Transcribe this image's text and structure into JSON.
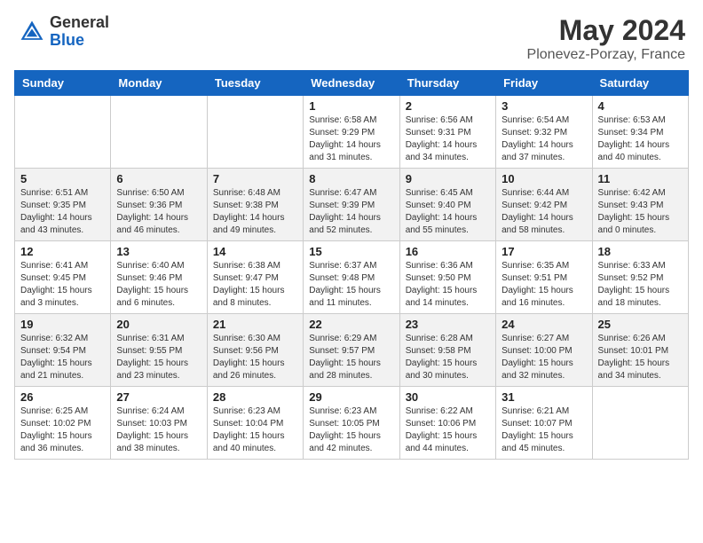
{
  "header": {
    "logo_general": "General",
    "logo_blue": "Blue",
    "title": "May 2024",
    "subtitle": "Plonevez-Porzay, France"
  },
  "days_of_week": [
    "Sunday",
    "Monday",
    "Tuesday",
    "Wednesday",
    "Thursday",
    "Friday",
    "Saturday"
  ],
  "weeks": [
    [
      {
        "day": "",
        "info": ""
      },
      {
        "day": "",
        "info": ""
      },
      {
        "day": "",
        "info": ""
      },
      {
        "day": "1",
        "info": "Sunrise: 6:58 AM\nSunset: 9:29 PM\nDaylight: 14 hours\nand 31 minutes."
      },
      {
        "day": "2",
        "info": "Sunrise: 6:56 AM\nSunset: 9:31 PM\nDaylight: 14 hours\nand 34 minutes."
      },
      {
        "day": "3",
        "info": "Sunrise: 6:54 AM\nSunset: 9:32 PM\nDaylight: 14 hours\nand 37 minutes."
      },
      {
        "day": "4",
        "info": "Sunrise: 6:53 AM\nSunset: 9:34 PM\nDaylight: 14 hours\nand 40 minutes."
      }
    ],
    [
      {
        "day": "5",
        "info": "Sunrise: 6:51 AM\nSunset: 9:35 PM\nDaylight: 14 hours\nand 43 minutes."
      },
      {
        "day": "6",
        "info": "Sunrise: 6:50 AM\nSunset: 9:36 PM\nDaylight: 14 hours\nand 46 minutes."
      },
      {
        "day": "7",
        "info": "Sunrise: 6:48 AM\nSunset: 9:38 PM\nDaylight: 14 hours\nand 49 minutes."
      },
      {
        "day": "8",
        "info": "Sunrise: 6:47 AM\nSunset: 9:39 PM\nDaylight: 14 hours\nand 52 minutes."
      },
      {
        "day": "9",
        "info": "Sunrise: 6:45 AM\nSunset: 9:40 PM\nDaylight: 14 hours\nand 55 minutes."
      },
      {
        "day": "10",
        "info": "Sunrise: 6:44 AM\nSunset: 9:42 PM\nDaylight: 14 hours\nand 58 minutes."
      },
      {
        "day": "11",
        "info": "Sunrise: 6:42 AM\nSunset: 9:43 PM\nDaylight: 15 hours\nand 0 minutes."
      }
    ],
    [
      {
        "day": "12",
        "info": "Sunrise: 6:41 AM\nSunset: 9:45 PM\nDaylight: 15 hours\nand 3 minutes."
      },
      {
        "day": "13",
        "info": "Sunrise: 6:40 AM\nSunset: 9:46 PM\nDaylight: 15 hours\nand 6 minutes."
      },
      {
        "day": "14",
        "info": "Sunrise: 6:38 AM\nSunset: 9:47 PM\nDaylight: 15 hours\nand 8 minutes."
      },
      {
        "day": "15",
        "info": "Sunrise: 6:37 AM\nSunset: 9:48 PM\nDaylight: 15 hours\nand 11 minutes."
      },
      {
        "day": "16",
        "info": "Sunrise: 6:36 AM\nSunset: 9:50 PM\nDaylight: 15 hours\nand 14 minutes."
      },
      {
        "day": "17",
        "info": "Sunrise: 6:35 AM\nSunset: 9:51 PM\nDaylight: 15 hours\nand 16 minutes."
      },
      {
        "day": "18",
        "info": "Sunrise: 6:33 AM\nSunset: 9:52 PM\nDaylight: 15 hours\nand 18 minutes."
      }
    ],
    [
      {
        "day": "19",
        "info": "Sunrise: 6:32 AM\nSunset: 9:54 PM\nDaylight: 15 hours\nand 21 minutes."
      },
      {
        "day": "20",
        "info": "Sunrise: 6:31 AM\nSunset: 9:55 PM\nDaylight: 15 hours\nand 23 minutes."
      },
      {
        "day": "21",
        "info": "Sunrise: 6:30 AM\nSunset: 9:56 PM\nDaylight: 15 hours\nand 26 minutes."
      },
      {
        "day": "22",
        "info": "Sunrise: 6:29 AM\nSunset: 9:57 PM\nDaylight: 15 hours\nand 28 minutes."
      },
      {
        "day": "23",
        "info": "Sunrise: 6:28 AM\nSunset: 9:58 PM\nDaylight: 15 hours\nand 30 minutes."
      },
      {
        "day": "24",
        "info": "Sunrise: 6:27 AM\nSunset: 10:00 PM\nDaylight: 15 hours\nand 32 minutes."
      },
      {
        "day": "25",
        "info": "Sunrise: 6:26 AM\nSunset: 10:01 PM\nDaylight: 15 hours\nand 34 minutes."
      }
    ],
    [
      {
        "day": "26",
        "info": "Sunrise: 6:25 AM\nSunset: 10:02 PM\nDaylight: 15 hours\nand 36 minutes."
      },
      {
        "day": "27",
        "info": "Sunrise: 6:24 AM\nSunset: 10:03 PM\nDaylight: 15 hours\nand 38 minutes."
      },
      {
        "day": "28",
        "info": "Sunrise: 6:23 AM\nSunset: 10:04 PM\nDaylight: 15 hours\nand 40 minutes."
      },
      {
        "day": "29",
        "info": "Sunrise: 6:23 AM\nSunset: 10:05 PM\nDaylight: 15 hours\nand 42 minutes."
      },
      {
        "day": "30",
        "info": "Sunrise: 6:22 AM\nSunset: 10:06 PM\nDaylight: 15 hours\nand 44 minutes."
      },
      {
        "day": "31",
        "info": "Sunrise: 6:21 AM\nSunset: 10:07 PM\nDaylight: 15 hours\nand 45 minutes."
      },
      {
        "day": "",
        "info": ""
      }
    ]
  ]
}
